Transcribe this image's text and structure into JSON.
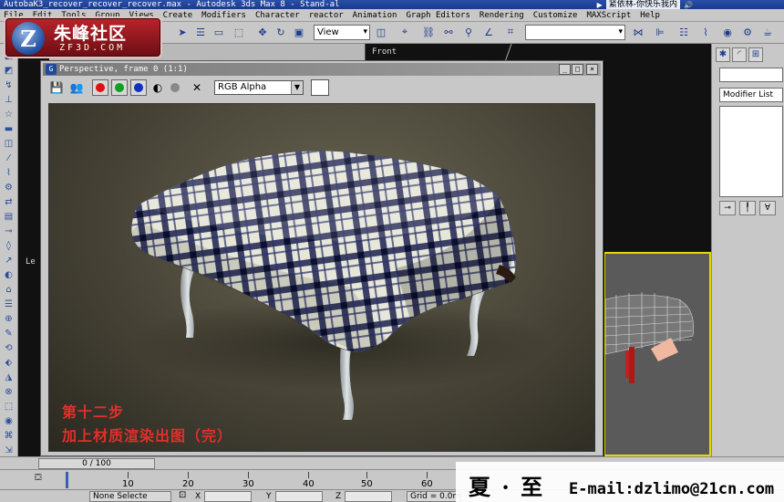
{
  "window": {
    "title": "AutobaK3_recover_recover_recover.max - Autodesk 3ds Max 8 - Stand-al",
    "media_song": "紧依林-你快乐我内"
  },
  "menu": [
    "File",
    "Edit",
    "Tools",
    "Group",
    "Views",
    "Create",
    "Modifiers",
    "Character",
    "reactor",
    "Animation",
    "Graph Editors",
    "Rendering",
    "Customize",
    "MAXScript",
    "Help"
  ],
  "toolbar": {
    "view_dropdown": "View"
  },
  "logo": {
    "mark": "Z",
    "chinese": "朱峰社区",
    "domain": "ZF3D.COM"
  },
  "viewports": {
    "front_label": "Front",
    "left_label": "Le"
  },
  "command_panel": {
    "modifier_list": "Modifier List"
  },
  "render_window": {
    "title": "Perspective, frame 0 (1:1)",
    "channel": "RGB Alpha",
    "caption_line1": "第十二步",
    "caption_line2": "加上材质渲染出图（完）"
  },
  "timeline": {
    "slider": "0 / 100",
    "ticks": [
      "10",
      "20",
      "30",
      "40",
      "50",
      "60"
    ]
  },
  "status": {
    "selection": "None Selecte",
    "x_label": "X",
    "y_label": "Y",
    "z_label": "Z",
    "grid": "Grid = 0.0m"
  },
  "signature": {
    "name": "夏 · 至",
    "email": "E-mail:dzlimo@21cn.com"
  },
  "colors": {
    "caption": "#e0302a",
    "active_viewport_border": "#e8d800",
    "title_blue": "#2a4fa8"
  }
}
